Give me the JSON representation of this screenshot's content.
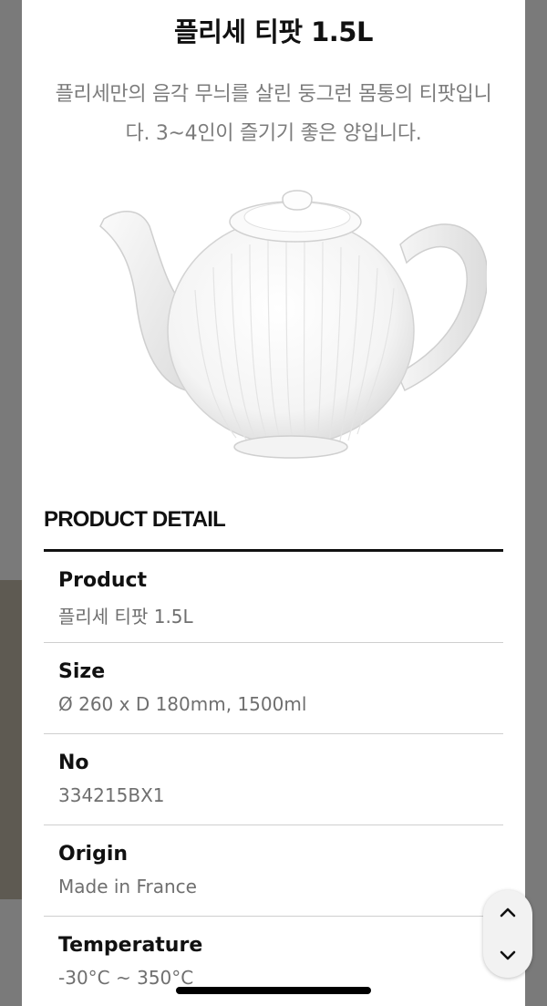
{
  "product": {
    "title": "플리세 티팟 1.5L",
    "description": "플리세만의 음각 무늬를 살린 둥그런 몸통의 티팟입니다. 3~4인이 즐기기 좋은 양입니다."
  },
  "detail": {
    "heading": "PRODUCT DETAIL",
    "specs": [
      {
        "label": "Product",
        "value": "플리세 티팟 1.5L"
      },
      {
        "label": "Size",
        "value": "Ø 260 x D 180mm, 1500ml"
      },
      {
        "label": "No",
        "value": "334215BX1"
      },
      {
        "label": "Origin",
        "value": "Made in France"
      },
      {
        "label": "Temperature",
        "value": "-30°C ~ 350°C"
      }
    ]
  },
  "controls": {
    "scroll_up_icon": "chevron-up-icon",
    "scroll_down_icon": "chevron-down-icon"
  }
}
